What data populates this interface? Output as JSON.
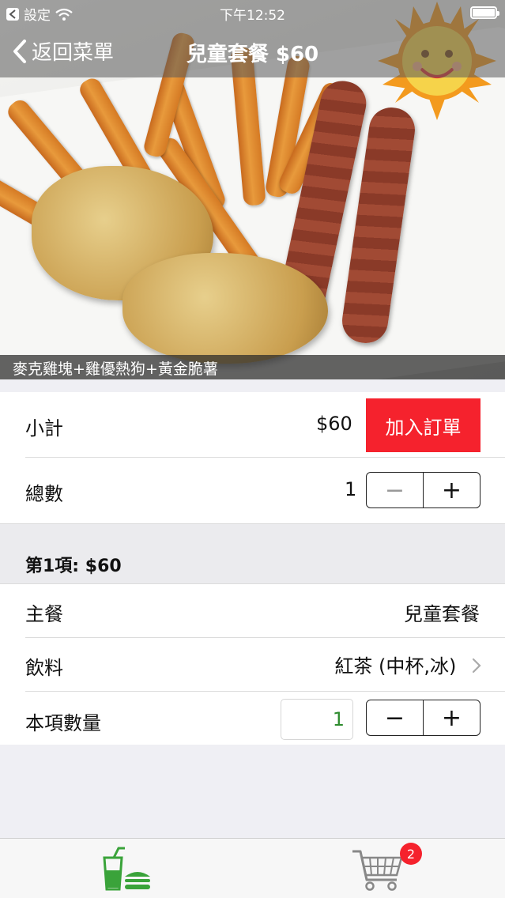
{
  "status_bar": {
    "back_app": "設定",
    "time": "下午12:52"
  },
  "nav": {
    "back_label": "返回菜單",
    "title": "兒童套餐 $60"
  },
  "hero": {
    "caption": "麥克雞塊+雞優熱狗+黃金脆薯"
  },
  "summary": {
    "subtotal_label": "小計",
    "subtotal_value": "$60",
    "add_order_label": "加入訂單",
    "total_label": "總數",
    "total_value": "1",
    "minus": "−",
    "plus": "+"
  },
  "item": {
    "header": "第1項: $60",
    "main_label": "主餐",
    "main_value": "兒童套餐",
    "drink_label": "飲料",
    "drink_value": "紅茶 (中杯,冰)",
    "qty_label": "本項數量",
    "qty_value": "1",
    "minus": "−",
    "plus": "+"
  },
  "tabbar": {
    "cart_badge": "2"
  },
  "colors": {
    "accent_red": "#f5222d",
    "menu_green": "#3aa33a",
    "qty_green": "#2e8b2e"
  }
}
